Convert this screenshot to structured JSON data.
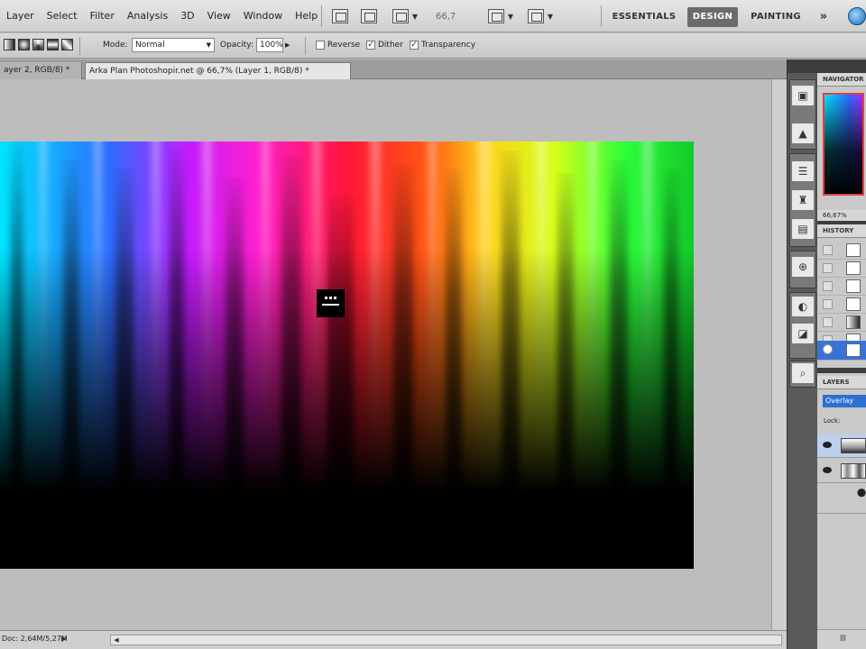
{
  "menus": [
    "Layer",
    "Select",
    "Filter",
    "Analysis",
    "3D",
    "View",
    "Window",
    "Help"
  ],
  "menubar": {
    "zoom_level": "66,7",
    "workspaces": [
      "ESSENTIALS",
      "DESIGN",
      "PAINTING"
    ],
    "active_workspace": "DESIGN",
    "more_symbol": "»"
  },
  "options": {
    "mode_label": "Mode:",
    "mode_value": "Normal",
    "opacity_label": "Opacity:",
    "opacity_value": "100%",
    "reverse_label": "Reverse",
    "reverse_checked": false,
    "dither_label": "Dither",
    "dither_checked": true,
    "transparency_label": "Transparency",
    "transparency_checked": true
  },
  "tabs": [
    {
      "label": "ayer 2, RGB/8) *",
      "active": false
    },
    {
      "label": "Arka Plan Photoshopir.net @ 66,7% (Layer 1, RGB/8) *",
      "active": true
    }
  ],
  "status": {
    "doc_size": "Doc: 2,64M/5,27M"
  },
  "panels": {
    "navigator_title": "NAVIGATOR",
    "navigator_zoom": "66,67%",
    "history_title": "HISTORY",
    "layers_title": "LAYERS",
    "blend_mode": "Overlay",
    "lock_label": "Lock:"
  },
  "colors": {
    "accent": "#2d6fd2",
    "workspace_bg": "#bdbdbd",
    "canvas_bg": "#000000"
  },
  "icons": {
    "dock": [
      "history-brush-icon",
      "channels-icon",
      "adjustments-icon",
      "masks-icon",
      "styles-icon",
      "brush-icon",
      "clone-source-icon",
      "3d-icon",
      "actions-icon"
    ]
  }
}
